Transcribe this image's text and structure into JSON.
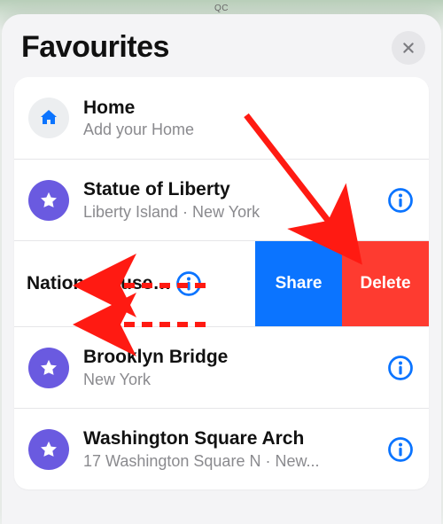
{
  "bg_label": "QC",
  "header": {
    "title": "Favourites",
    "close_icon": "close-icon"
  },
  "rows": {
    "home": {
      "title": "Home",
      "subtitle": "Add your Home"
    },
    "r1": {
      "title": "Statue of Liberty",
      "subtitle": "Liberty Island · New York"
    },
    "swiped": {
      "title": "National Muse…",
      "share": "Share",
      "delete": "Delete"
    },
    "r3": {
      "title": "Brooklyn Bridge",
      "subtitle": "New York"
    },
    "r4": {
      "title": "Washington Square Arch",
      "subtitle": "17 Washington Square N · New..."
    }
  },
  "colors": {
    "accent": "#0b74ff",
    "danger": "#fe3b30",
    "star_bg": "#6a5ae0",
    "home_icon": "#0b74ff",
    "info": "#0b74ff",
    "arrow": "#ff1a12"
  }
}
